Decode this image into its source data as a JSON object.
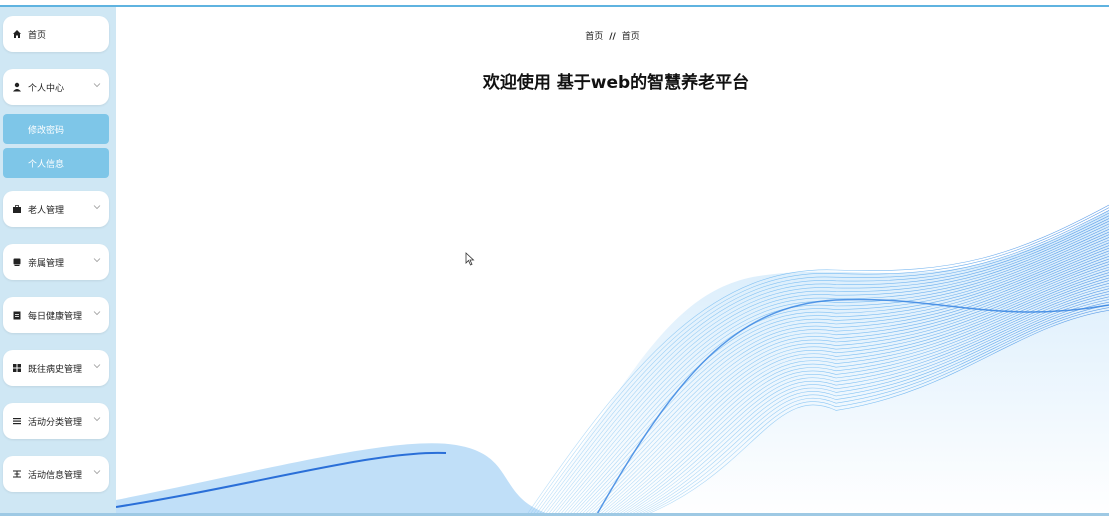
{
  "sidebar": {
    "items": [
      {
        "label": "首页",
        "icon": "home-icon"
      },
      {
        "label": "个人中心",
        "icon": "user-icon",
        "expanded": true,
        "children": [
          {
            "label": "修改密码"
          },
          {
            "label": "个人信息"
          }
        ]
      },
      {
        "label": "老人管理",
        "icon": "briefcase-icon"
      },
      {
        "label": "亲属管理",
        "icon": "drive-icon"
      },
      {
        "label": "每日健康管理",
        "icon": "clipboard-icon"
      },
      {
        "label": "既往病史管理",
        "icon": "grid-icon"
      },
      {
        "label": "活动分类管理",
        "icon": "list-icon"
      },
      {
        "label": "活动信息管理",
        "icon": "align-icon"
      }
    ]
  },
  "breadcrumb": {
    "home": "首页",
    "separator": "//",
    "current": "首页"
  },
  "main": {
    "title": "欢迎使用 基于web的智慧养老平台"
  },
  "colors": {
    "accent": "#7ec6e8",
    "sidebar_bg": "#cfe7f4",
    "wave": "#2f8fe0"
  }
}
